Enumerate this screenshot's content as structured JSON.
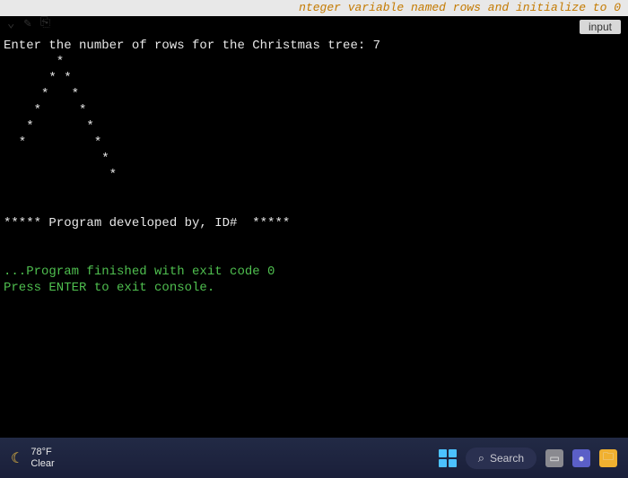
{
  "editor": {
    "fragment": "nteger variable named rows and initialize to 0"
  },
  "input_label": "input",
  "console": {
    "prompt": "Enter the number of rows for the Christmas tree: 7",
    "tree_lines": [
      "       *",
      "      * *",
      "     *   *",
      "    *     *",
      "   *       *",
      "  *         *",
      "             *",
      "              *",
      "",
      "",
      "***** Program developed by, ID#  *****"
    ],
    "finish_lines": [
      "...Program finished with exit code 0",
      "Press ENTER to exit console."
    ]
  },
  "taskbar": {
    "weather": {
      "temp": "78°F",
      "condition": "Clear"
    },
    "search_text": "Search"
  }
}
